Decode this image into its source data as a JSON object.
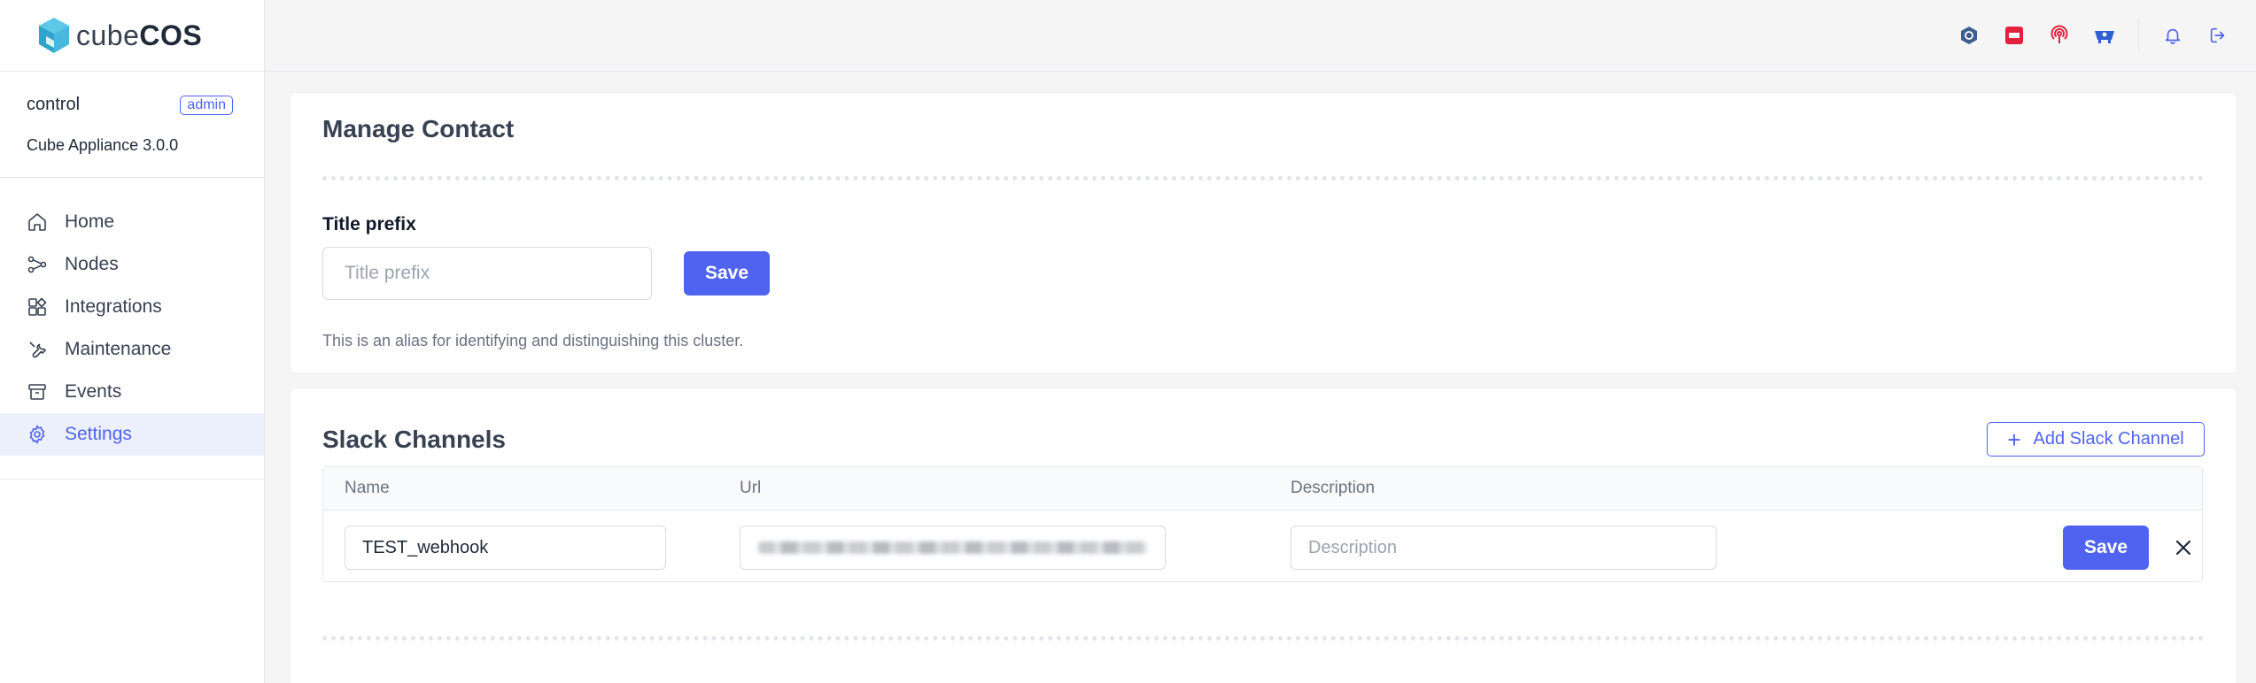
{
  "brand": {
    "name_a": "cube",
    "name_b": "COS"
  },
  "account": {
    "user": "control",
    "role": "admin",
    "appliance": "Cube Appliance 3.0.0"
  },
  "sidebar": {
    "items": [
      {
        "label": "Home",
        "icon": "home-icon"
      },
      {
        "label": "Nodes",
        "icon": "nodes-icon"
      },
      {
        "label": "Integrations",
        "icon": "integrations-icon"
      },
      {
        "label": "Maintenance",
        "icon": "wrench-icon"
      },
      {
        "label": "Events",
        "icon": "archive-icon"
      },
      {
        "label": "Settings",
        "icon": "gear-icon",
        "active": true
      }
    ]
  },
  "header": {
    "icons": [
      "ceph-icon",
      "openstack-icon",
      "podcast-icon",
      "kubernetes-icon",
      "bell-icon",
      "logout-icon"
    ]
  },
  "manage_contact": {
    "title": "Manage Contact",
    "field_label": "Title prefix",
    "placeholder": "Title prefix",
    "save_label": "Save",
    "hint": "This is an alias for identifying and distinguishing this cluster."
  },
  "slack": {
    "title": "Slack Channels",
    "add_label": "Add Slack Channel",
    "columns": [
      "Name",
      "Url",
      "Description"
    ],
    "rows": [
      {
        "name": "TEST_webhook",
        "url": "",
        "description_placeholder": "Description",
        "save_label": "Save"
      }
    ]
  },
  "colors": {
    "accent": "#4f63f0",
    "active_bg": "#eceffc",
    "logo": "#3cb6d9"
  }
}
